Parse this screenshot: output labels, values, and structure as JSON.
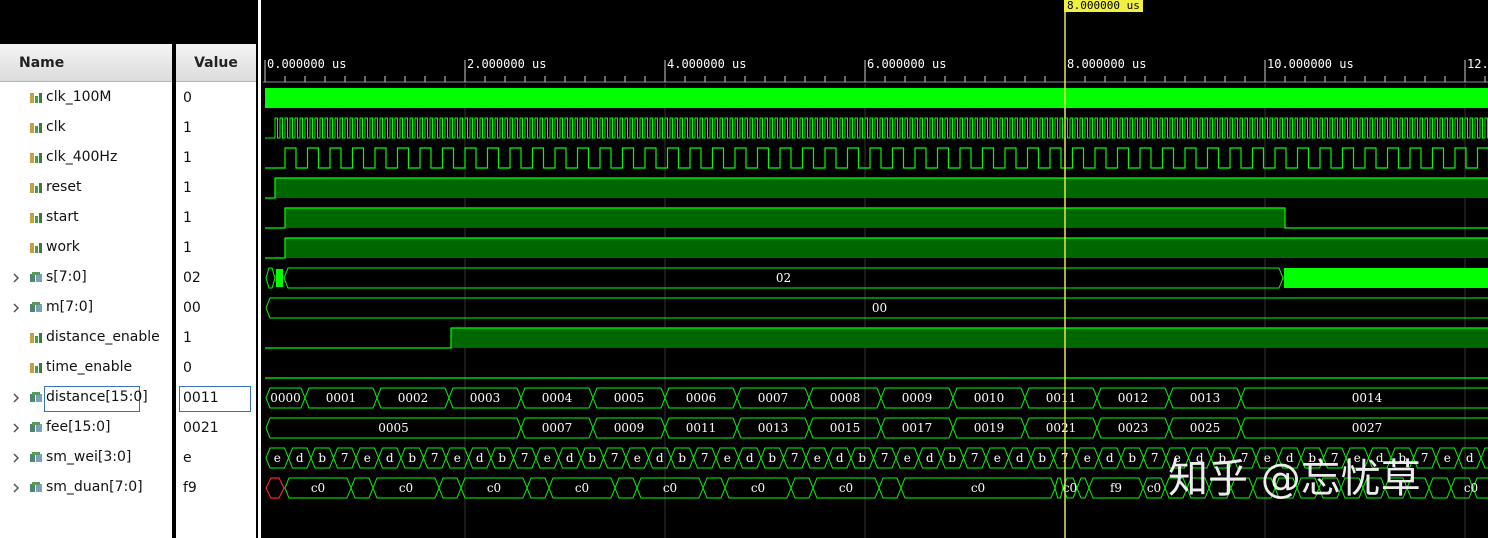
{
  "headers": {
    "name": "Name",
    "value": "Value"
  },
  "cursor": {
    "label": "8.000000 us",
    "time_us": 8.0
  },
  "ruler": {
    "unit": "us",
    "labels": [
      "0.000000 us",
      "2.000000 us",
      "4.000000 us",
      "6.000000 us",
      "8.000000 us",
      "10.000000 us",
      "12."
    ]
  },
  "colors": {
    "wave": "#00ff00",
    "wave_dark": "#006600",
    "cursor": "#e8e850",
    "background": "#000000",
    "grid": "#333333"
  },
  "signals": [
    {
      "name": "clk_100M",
      "value": "0",
      "kind": "bit",
      "expandable": false
    },
    {
      "name": "clk",
      "value": "1",
      "kind": "bit",
      "expandable": false
    },
    {
      "name": "clk_400Hz",
      "value": "1",
      "kind": "bit",
      "expandable": false
    },
    {
      "name": "reset",
      "value": "1",
      "kind": "bit",
      "expandable": false
    },
    {
      "name": "start",
      "value": "1",
      "kind": "bit",
      "expandable": false
    },
    {
      "name": "work",
      "value": "1",
      "kind": "bit",
      "expandable": false
    },
    {
      "name": "s[7:0]",
      "value": "02",
      "kind": "bus",
      "expandable": true
    },
    {
      "name": "m[7:0]",
      "value": "00",
      "kind": "bus",
      "expandable": true
    },
    {
      "name": "distance_enable",
      "value": "1",
      "kind": "bit",
      "expandable": false
    },
    {
      "name": "time_enable",
      "value": "0",
      "kind": "bit",
      "expandable": false
    },
    {
      "name": "distance[15:0]",
      "value": "0011",
      "kind": "bus",
      "expandable": true,
      "selected": true
    },
    {
      "name": "fee[15:0]",
      "value": "0021",
      "kind": "bus",
      "expandable": true
    },
    {
      "name": "sm_wei[3:0]",
      "value": "e",
      "kind": "bus",
      "expandable": true
    },
    {
      "name": "sm_duan[7:0]",
      "value": "f9",
      "kind": "bus",
      "expandable": true
    }
  ],
  "bus_values": {
    "s": [
      "02"
    ],
    "m": [
      "00"
    ],
    "distance": [
      "0000",
      "0001",
      "0002",
      "0003",
      "0004",
      "0005",
      "0006",
      "0007",
      "0008",
      "0009",
      "0010",
      "0011",
      "0012",
      "0013",
      "0014"
    ],
    "fee": [
      "0005",
      "0007",
      "0009",
      "0011",
      "0013",
      "0015",
      "0017",
      "0019",
      "0021",
      "0023",
      "0025",
      "0027"
    ],
    "sm_wei_cycle": [
      "e",
      "d",
      "b",
      "7"
    ],
    "sm_duan": [
      "c0",
      "c0",
      "c0",
      "c0",
      "c0",
      "c0",
      "c0",
      "c0",
      "c0",
      "f9",
      "c0",
      "c0"
    ]
  },
  "watermark": "知乎 @忘忧草"
}
